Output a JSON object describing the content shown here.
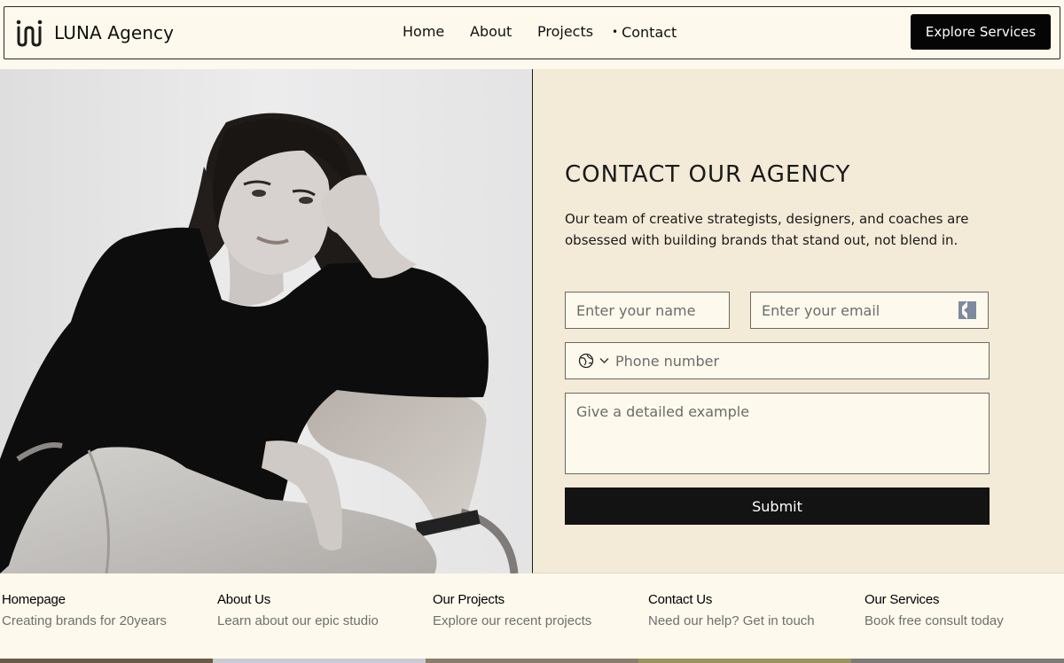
{
  "brand": {
    "name": "LUNA Agency"
  },
  "nav": {
    "items": [
      {
        "label": "Home"
      },
      {
        "label": "About"
      },
      {
        "label": "Projects"
      },
      {
        "label": "Contact",
        "active": true
      }
    ],
    "cta_label": "Explore Services"
  },
  "hero_image": {
    "icon": "portrait-photo",
    "style": "black and white"
  },
  "contact": {
    "title": "CONTACT OUR AGENCY",
    "description": "Our team of creative strategists, designers, and coaches are obsessed with building brands that stand out, not blend in.",
    "form": {
      "name_placeholder": "Enter your name",
      "email_placeholder": "Enter your email",
      "phone_placeholder": "Phone number",
      "message_placeholder": "Give a detailed example",
      "submit_label": "Submit"
    }
  },
  "footer": {
    "links": [
      {
        "title": "Homepage",
        "subtitle": "Creating brands for 20years"
      },
      {
        "title": "About Us",
        "subtitle": "Learn about our epic studio"
      },
      {
        "title": "Our Projects",
        "subtitle": "Explore our recent projects"
      },
      {
        "title": "Contact Us",
        "subtitle": "Need our help? Get in touch"
      },
      {
        "title": "Our Services",
        "subtitle": "Book free consult today"
      }
    ]
  },
  "colors": {
    "page_bg": "#fdf9ec",
    "panel_bg": "#f3ead7",
    "button_bg": "#050505",
    "text": "#111111",
    "muted_text": "#6f6f6f"
  }
}
